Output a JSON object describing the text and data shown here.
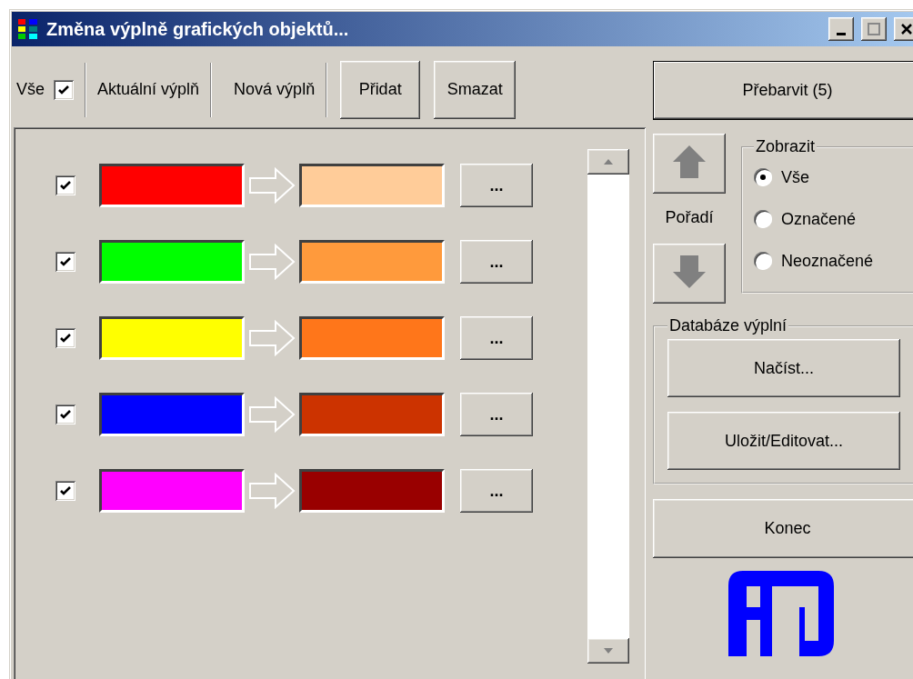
{
  "window": {
    "title": "Změna výplně grafických objektů..."
  },
  "header": {
    "all_label": "Vše",
    "all_checked": true,
    "current_label": "Aktuální výplň",
    "new_label": "Nová výplň"
  },
  "buttons": {
    "add": "Přidat",
    "delete": "Smazat",
    "recolor": "Přebarvit (5)"
  },
  "rows": [
    {
      "checked": true,
      "current_fill": {
        "color": "#ff0000"
      },
      "new_fill": {
        "color": "#ffcc99"
      },
      "button": "..."
    },
    {
      "checked": true,
      "current_fill": {
        "color": "#00ff00"
      },
      "new_fill": {
        "color": "#ff9a3c"
      },
      "button": "..."
    },
    {
      "checked": true,
      "current_fill": {
        "color": "#ffff00"
      },
      "new_fill": {
        "color": "#ff761a"
      },
      "button": "..."
    },
    {
      "checked": true,
      "current_fill": {
        "color": "#0000ff"
      },
      "new_fill": {
        "color": "#cc3300"
      },
      "button": "..."
    },
    {
      "checked": true,
      "current_fill": {
        "color": "#ff00ff"
      },
      "new_fill": {
        "color": "#990000"
      },
      "button": "..."
    }
  ],
  "order": {
    "label": "Pořadí"
  },
  "show": {
    "title": "Zobrazit",
    "options": [
      {
        "label": "Vše",
        "selected": true
      },
      {
        "label": "Označené",
        "selected": false
      },
      {
        "label": "Neoznačené",
        "selected": false
      }
    ]
  },
  "database": {
    "title": "Databáze výplní",
    "buttons": [
      "Načíst...",
      "Uložit/Editovat..."
    ]
  },
  "exit_button": "Konec"
}
